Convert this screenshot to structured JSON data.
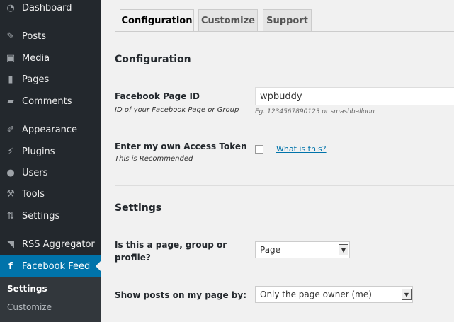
{
  "menu": [
    {
      "label": "Dashboard",
      "icon": "dashboard-icon"
    },
    {
      "label": "Posts",
      "icon": "pin-icon"
    },
    {
      "label": "Media",
      "icon": "media-icon"
    },
    {
      "label": "Pages",
      "icon": "pages-icon"
    },
    {
      "label": "Comments",
      "icon": "comment-icon"
    },
    {
      "label": "Appearance",
      "icon": "brush-icon"
    },
    {
      "label": "Plugins",
      "icon": "plug-icon"
    },
    {
      "label": "Users",
      "icon": "user-icon"
    },
    {
      "label": "Tools",
      "icon": "wrench-icon"
    },
    {
      "label": "Settings",
      "icon": "settings-icon"
    },
    {
      "label": "RSS Aggregator",
      "icon": "rss-icon"
    },
    {
      "label": "Facebook Feed",
      "icon": "facebook-icon"
    }
  ],
  "submenu": [
    "Settings",
    "Customize"
  ],
  "tabs": [
    "Configuration",
    "Customize",
    "Support"
  ],
  "config": {
    "heading": "Configuration",
    "page_id_label": "Facebook Page ID",
    "page_id_hint": "ID of your Facebook Page or Group",
    "page_id_value": "wpbuddy",
    "page_id_example": "Eg. 1234567890123 or smashballoon",
    "token_label": "Enter my own Access Token",
    "token_hint": "This is Recommended",
    "token_link": "What is this?"
  },
  "settings": {
    "heading": "Settings",
    "type_label_1": "Is this a page, group or",
    "type_label_2": "profile?",
    "type_value": "Page",
    "show_label": "Show posts on my page by:",
    "show_value": "Only the page owner (me)"
  }
}
